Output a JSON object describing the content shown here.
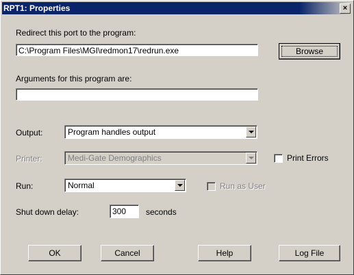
{
  "window": {
    "title": "RPT1: Properties",
    "close_glyph": "×"
  },
  "redirect": {
    "label": "Redirect this port to the program:",
    "value": "C:\\Program Files\\MGI\\redmon17\\redrun.exe",
    "browse_label": "Browse"
  },
  "arguments": {
    "label": "Arguments for this program are:",
    "value": ""
  },
  "output": {
    "label": "Output:",
    "selected": "Program handles output"
  },
  "printer": {
    "label": "Printer:",
    "selected": "Medi-Gate Demographics"
  },
  "print_errors": {
    "label": "Print Errors",
    "checked": false
  },
  "run": {
    "label": "Run:",
    "selected": "Normal"
  },
  "run_as_user": {
    "label": "Run as User",
    "checked": false
  },
  "shutdown": {
    "label": "Shut down delay:",
    "value": "300",
    "units": "seconds"
  },
  "buttons": {
    "ok": "OK",
    "cancel": "Cancel",
    "help": "Help",
    "log_file": "Log File"
  }
}
